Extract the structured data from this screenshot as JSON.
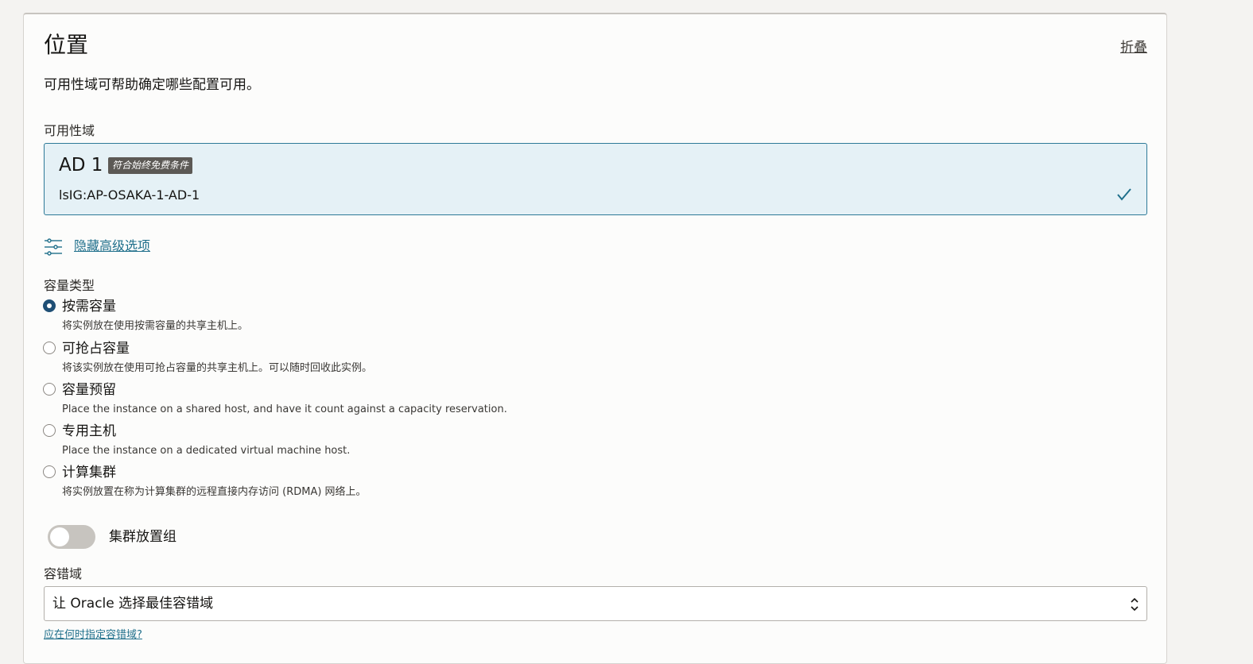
{
  "section": {
    "title": "位置",
    "collapse_label": "折叠",
    "description": "可用性域可帮助确定哪些配置可用。"
  },
  "availability_domain": {
    "label": "可用性域",
    "selected": {
      "name": "AD 1",
      "badge": "符合始终免费条件",
      "id": "lsIG:AP-OSAKA-1-AD-1"
    }
  },
  "advanced": {
    "link_label": "隐藏高级选项"
  },
  "capacity": {
    "label": "容量类型",
    "options": [
      {
        "title": "按需容量",
        "desc": "将实例放在使用按需容量的共享主机上。",
        "selected": true
      },
      {
        "title": "可抢占容量",
        "desc": "将该实例放在使用可抢占容量的共享主机上。可以随时回收此实例。",
        "selected": false
      },
      {
        "title": "容量预留",
        "desc": "Place the instance on a shared host, and have it count against a capacity reservation.",
        "selected": false
      },
      {
        "title": "专用主机",
        "desc": "Place the instance on a dedicated virtual machine host.",
        "selected": false
      },
      {
        "title": "计算集群",
        "desc": "将实例放置在称为计算集群的远程直接内存访问 (RDMA) 网络上。",
        "selected": false
      }
    ]
  },
  "cluster_placement": {
    "label": "集群放置组",
    "enabled": false
  },
  "fault_domain": {
    "label": "容错域",
    "value": "让 Oracle 选择最佳容错域",
    "help_link": "应在何时指定容错域?"
  },
  "colors": {
    "accent": "#1f4f75",
    "link": "#1f6f8b",
    "selected_bg": "#e5f1f6"
  }
}
